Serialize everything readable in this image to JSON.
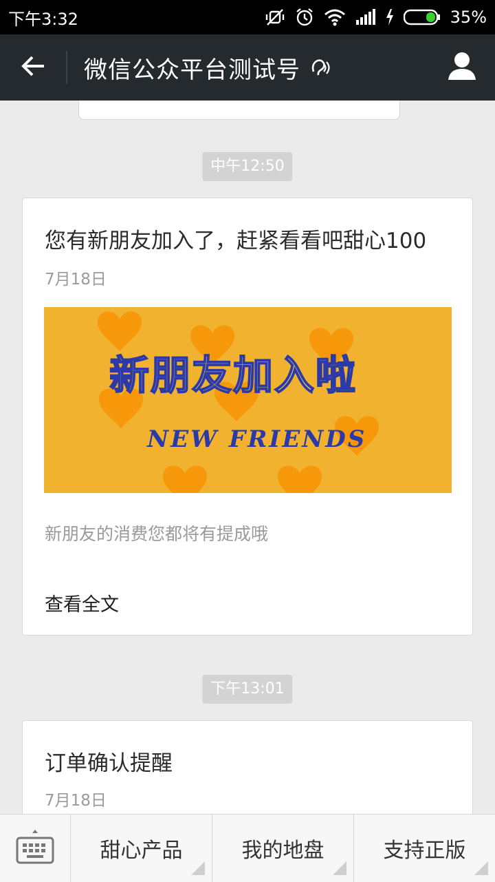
{
  "status": {
    "time": "下午3:32",
    "battery": "35%"
  },
  "header": {
    "title": "微信公众平台测试号"
  },
  "messages": [
    {
      "time": "中午12:50",
      "title": "您有新朋友加入了，赶紧看看吧甜心100",
      "date": "7月18日",
      "image": {
        "headline": "新朋友加入啦",
        "subline": "NEW FRIENDS"
      },
      "desc": "新朋友的消费您都将有提成哦",
      "more": "查看全文"
    },
    {
      "time": "下午13:01",
      "title": "订单确认提醒",
      "date": "7月18日"
    }
  ],
  "menu": {
    "items": [
      {
        "label": "甜心产品"
      },
      {
        "label": "我的地盘"
      },
      {
        "label": "支持正版"
      }
    ]
  },
  "colors": {
    "status_bar": "#000000",
    "title_bar": "#242a2e",
    "chat_bg": "#ebebeb",
    "banner": "#f0b22f",
    "heart": "#f6980a",
    "banner_text": "#2b3aa6"
  },
  "icons": [
    "back-arrow-icon",
    "earpiece-icon",
    "profile-icon",
    "keyboard-icon",
    "silent-icon",
    "alarm-icon",
    "wifi-icon",
    "signal-icon",
    "charging-icon",
    "battery-icon"
  ]
}
